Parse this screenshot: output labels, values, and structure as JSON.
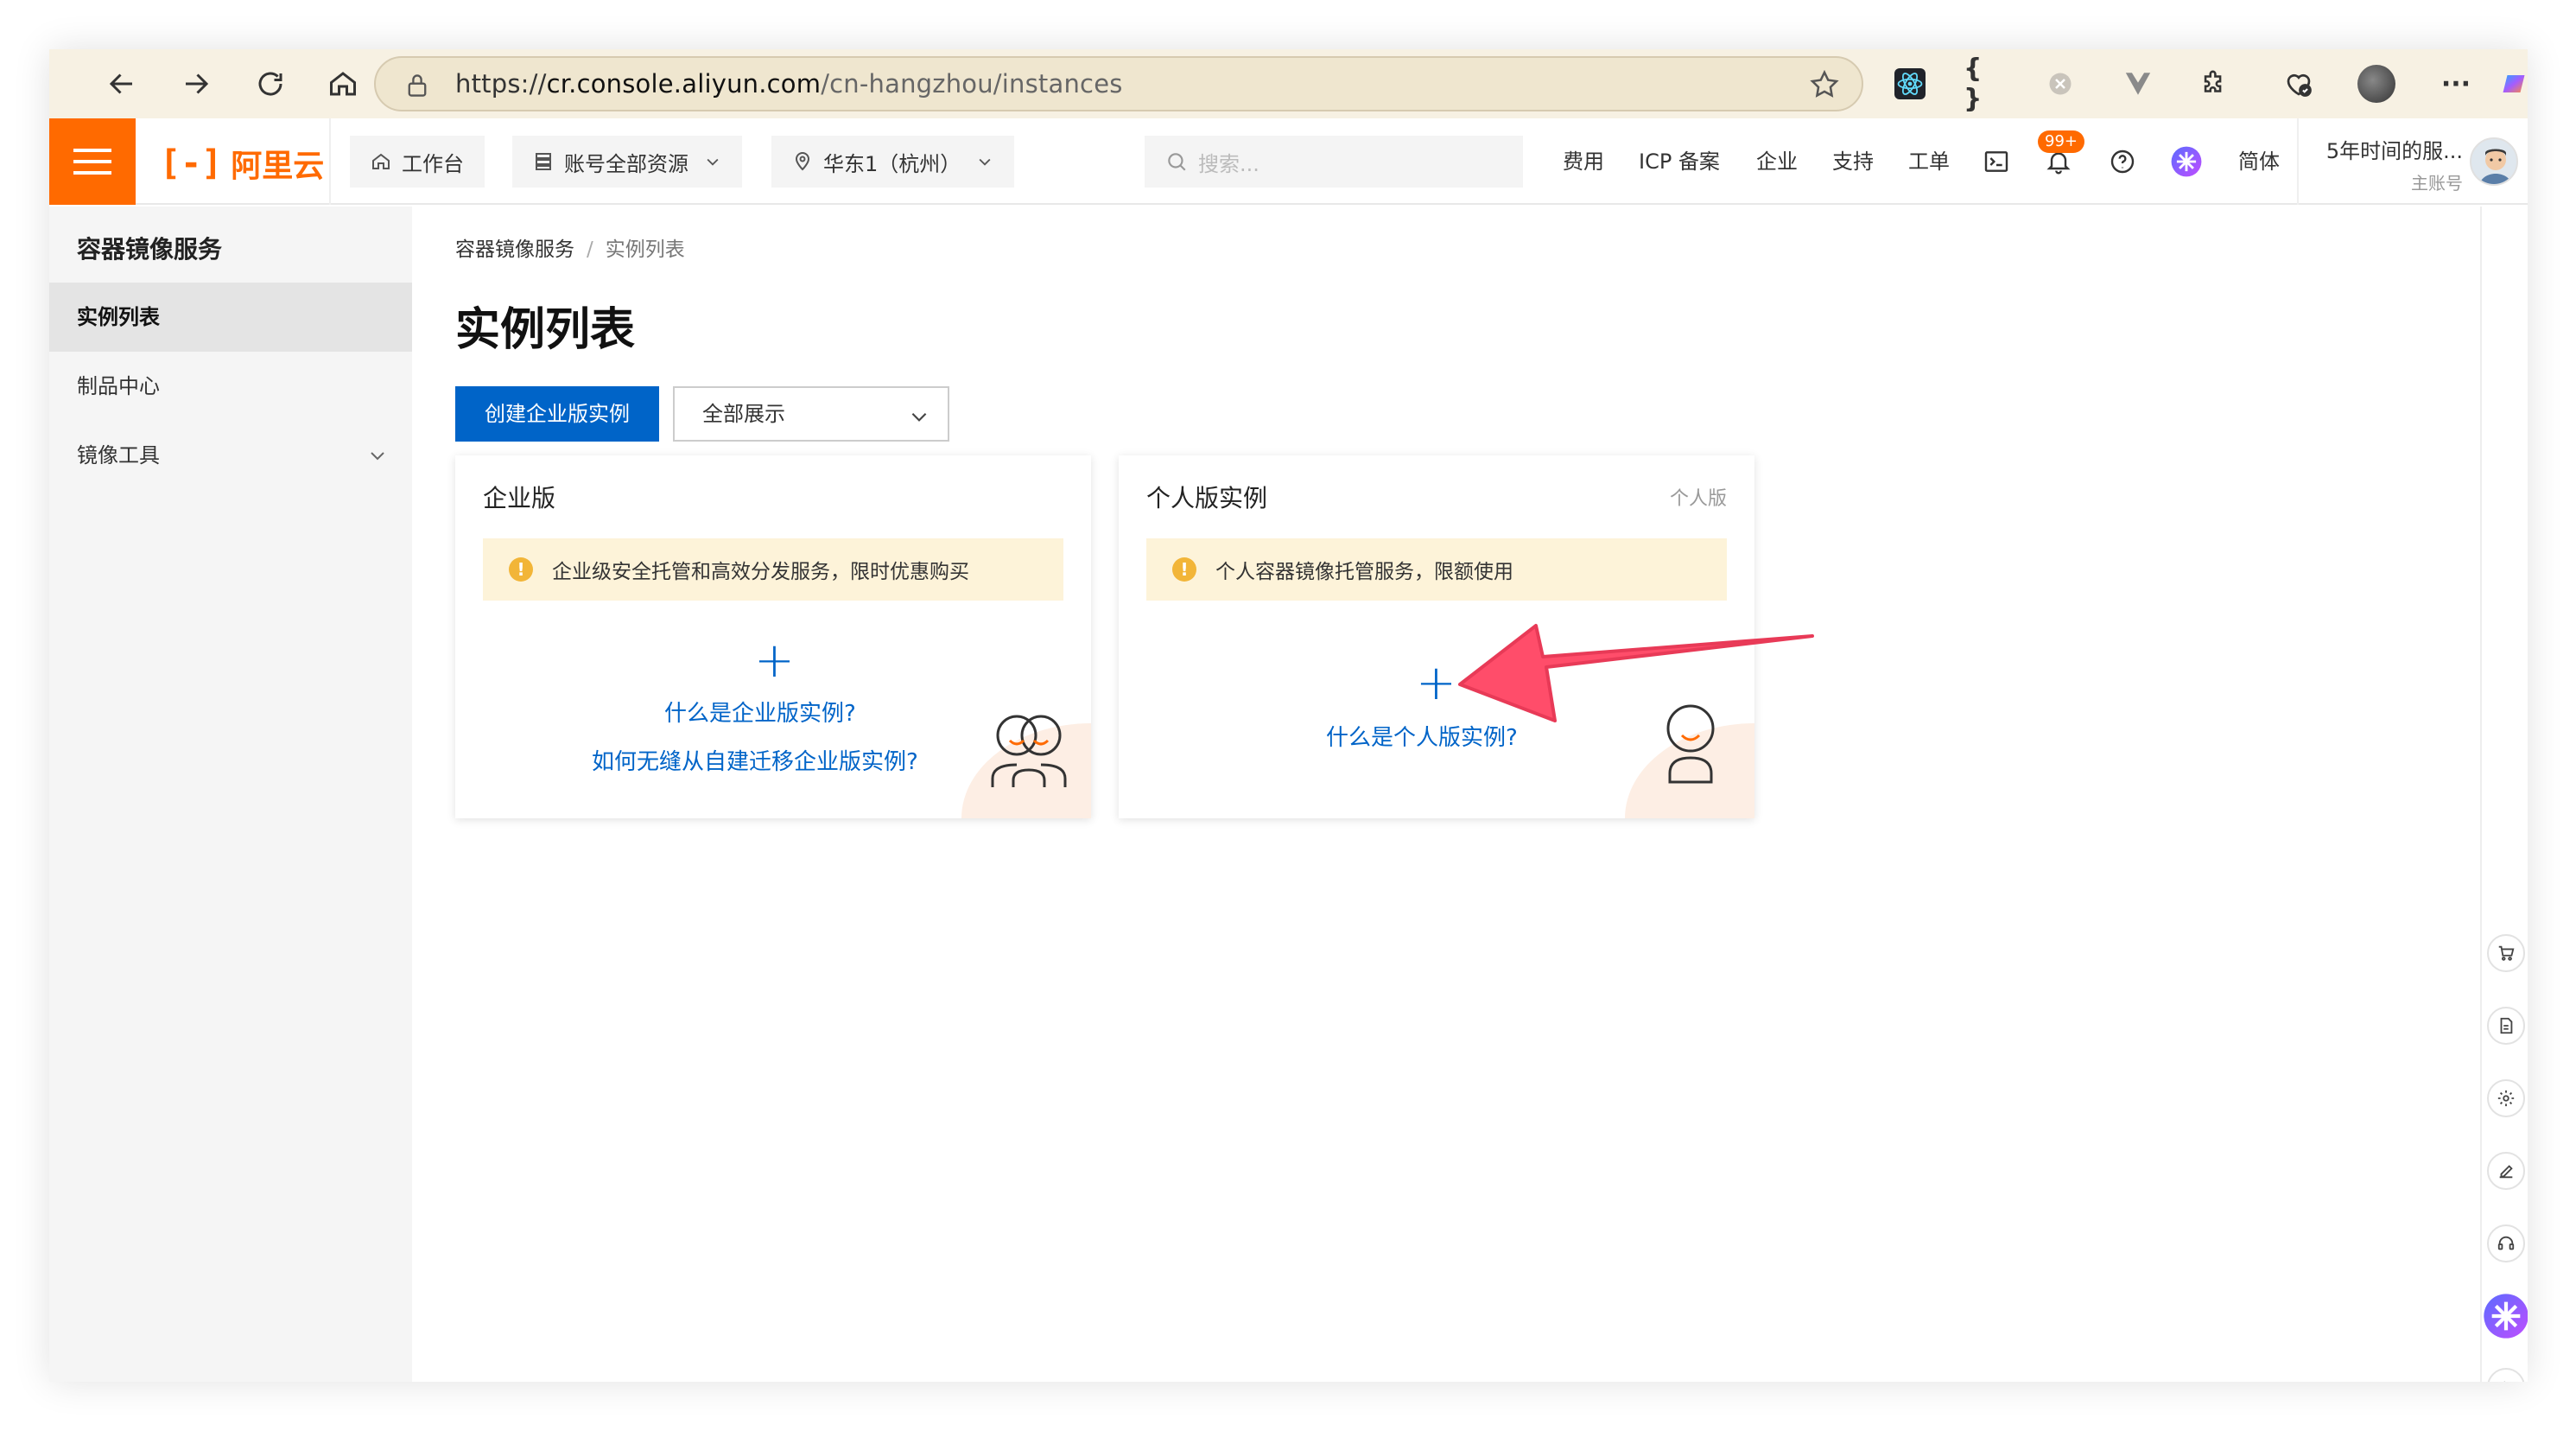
{
  "browser": {
    "url_prefix": "https://",
    "url_host": "cr.console.aliyun.com",
    "url_path": "/cn-hangzhou/instances",
    "ext_braces": "{ }",
    "ext_more": "···"
  },
  "topnav": {
    "logo_mark": "[-]",
    "logo_text": "阿里云",
    "workbench": "工作台",
    "resources": "账号全部资源",
    "region": "华东1（杭州）",
    "search_placeholder": "搜索...",
    "links": [
      "费用",
      "ICP 备案",
      "企业",
      "支持",
      "工单"
    ],
    "notification_badge": "99+",
    "language": "简体",
    "account_name": "5年时间的服...",
    "account_type": "主账号"
  },
  "sidebar": {
    "title": "容器镜像服务",
    "items": [
      {
        "label": "实例列表",
        "active": true
      },
      {
        "label": "制品中心",
        "active": false
      },
      {
        "label": "镜像工具",
        "active": false,
        "expandable": true
      }
    ]
  },
  "main": {
    "breadcrumb": [
      "容器镜像服务",
      "实例列表"
    ],
    "breadcrumb_sep": "/",
    "page_title": "实例列表",
    "create_button": "创建企业版实例",
    "filter_select": "全部展示",
    "cards": [
      {
        "title": "企业版",
        "tag": "",
        "notice": "企业级安全托管和高效分发服务，限时优惠购买",
        "plus": "+",
        "links": [
          "什么是企业版实例?",
          "如何无缝从自建迁移企业版实例?"
        ]
      },
      {
        "title": "个人版实例",
        "tag": "个人版",
        "notice": "个人容器镜像托管服务，限额使用",
        "plus": "+",
        "links": [
          "什么是个人版实例?"
        ]
      }
    ]
  },
  "colors": {
    "brand": "#ff6a00",
    "primary": "#0064c8",
    "annotation_arrow": "#ff4d6a",
    "notice_bg": "#fdf3d9"
  }
}
